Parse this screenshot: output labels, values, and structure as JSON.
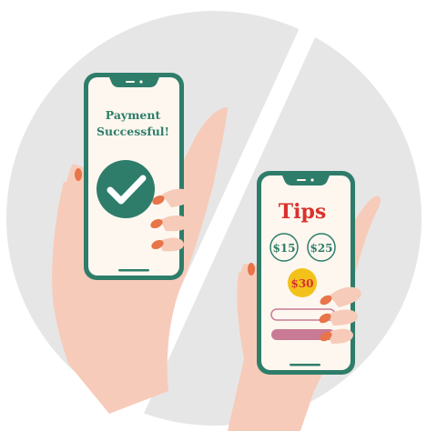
{
  "left_phone": {
    "heading_line1": "Payment",
    "heading_line2": "Successful!",
    "check_icon": "checkmark-icon"
  },
  "right_phone": {
    "title": "Tips",
    "tip_options": [
      {
        "label": "$15",
        "selected": false
      },
      {
        "label": "$25",
        "selected": false
      },
      {
        "label": "$30",
        "selected": true
      }
    ]
  },
  "colors": {
    "phone_frame": "#2e7d6a",
    "screen_bg": "#fdf7ef",
    "backdrop": "#e6e6e6",
    "skin": "#f7cbb9",
    "nail": "#e8744a",
    "tips_title": "#d9322c",
    "selected_tip": "#f3c21a",
    "tip_text": "#2e7d6a",
    "bar": "#c97a95"
  }
}
